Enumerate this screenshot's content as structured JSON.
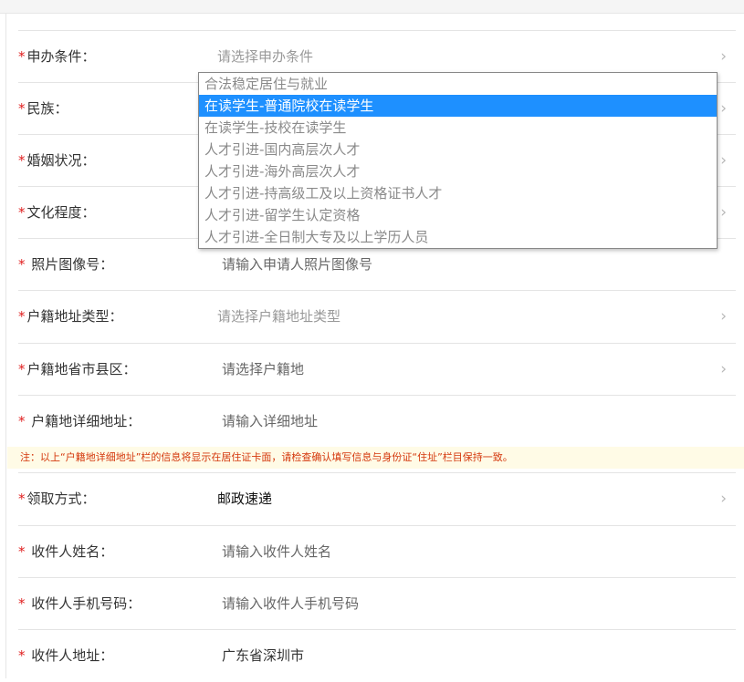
{
  "form": {
    "rows": [
      {
        "label": "申办条件：",
        "value": "请选择申办条件",
        "chevron": "›"
      },
      {
        "label": "民族：",
        "value": "",
        "chevron": "›"
      },
      {
        "label": "婚姻状况：",
        "value": "",
        "chevron": "›"
      },
      {
        "label": "文化程度：",
        "value": "",
        "chevron": "›"
      },
      {
        "label": " 照片图像号：",
        "value": "请输入申请人照片图像号"
      },
      {
        "label": "户籍地址类型：",
        "value": "请选择户籍地址类型",
        "chevron": "›"
      },
      {
        "label": "户籍地省市县区：",
        "value": "请选择户籍地",
        "chevron": "›"
      },
      {
        "label": " 户籍地详细地址：",
        "value": "请输入详细地址"
      },
      {
        "label": "领取方式：",
        "value": "邮政速递",
        "chevron": "›"
      },
      {
        "label": " 收件人姓名：",
        "value": "请输入收件人姓名"
      },
      {
        "label": " 收件人手机号码：",
        "value": "请输入收件人手机号码"
      },
      {
        "label": " 收件人地址：",
        "value": "广东省深圳市"
      }
    ],
    "required_mark": "*",
    "notice": "注：以上“户籍地详细地址”栏的信息将显示在居住证卡面，请检查确认填写信息与身份证“住址”栏目保持一致。"
  },
  "dropdown": {
    "options": [
      "合法稳定居住与就业",
      "在读学生-普通院校在读学生",
      "在读学生-技校在读学生",
      "人才引进-国内高层次人才",
      "人才引进-海外高层次人才",
      "人才引进-持高级工及以上资格证书人才",
      "人才引进-留学生认定资格",
      "人才引进-全日制大专及以上学历人员"
    ],
    "highlighted": "在读学生-普通院校在读学生"
  },
  "colors": {
    "required": "#e02020",
    "highlight": "#1e90ff",
    "notice_text": "#d4380d",
    "notice_bg": "#fffbe6"
  },
  "icons": {
    "chevron": "chevron-right-icon"
  }
}
